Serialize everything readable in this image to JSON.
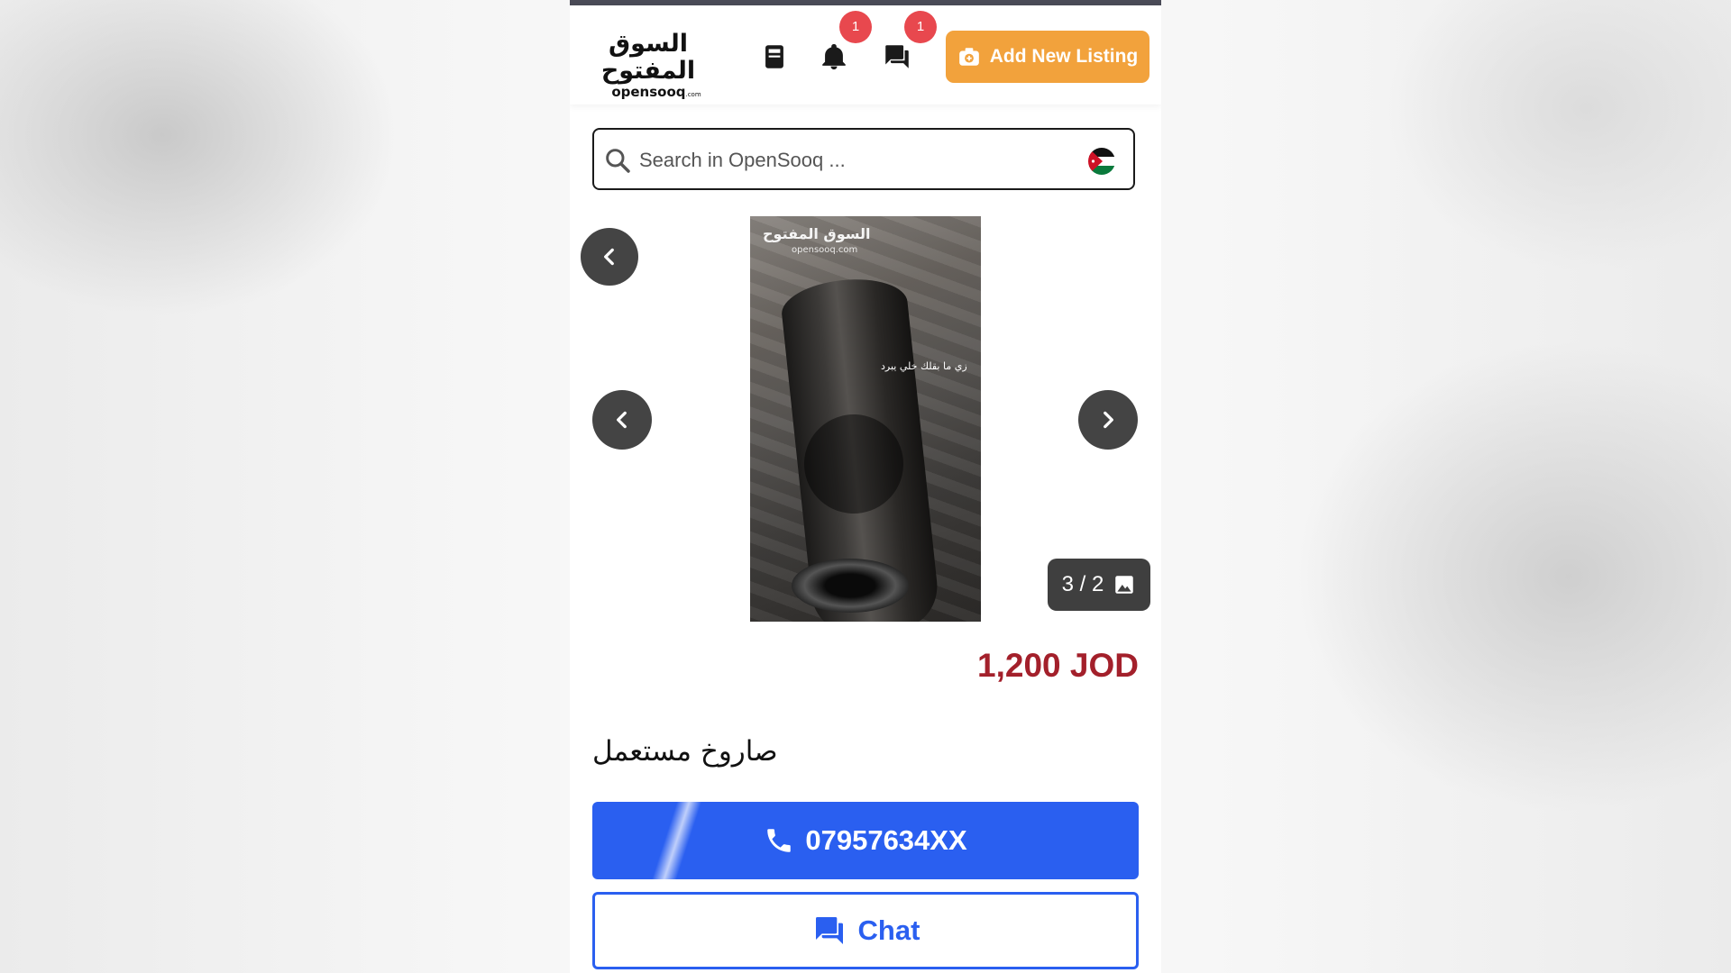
{
  "header": {
    "logo_arabic": "السوق المفتوح",
    "logo_latin": "opensooq",
    "logo_suffix": ".com",
    "notifications_badge": "1",
    "messages_badge": "1",
    "add_listing_label": "Add New Listing",
    "accent_color": "#f2a23c"
  },
  "search": {
    "placeholder": "Search in OpenSooq ...",
    "country_flag_icon": "jordan-flag-icon"
  },
  "gallery": {
    "counter": "3 / 2",
    "watermark_arabic": "السوق المفتوح",
    "watermark_latin": "opensooq.com",
    "photo_caption": "زي ما بقلك خلي يبرد"
  },
  "listing": {
    "price": "1,200 JOD",
    "price_color": "#a3202b",
    "title": "صاروخ مستعمل"
  },
  "actions": {
    "phone_label": "07957634XX",
    "chat_label": "Chat",
    "primary_color": "#2a5ff0"
  }
}
